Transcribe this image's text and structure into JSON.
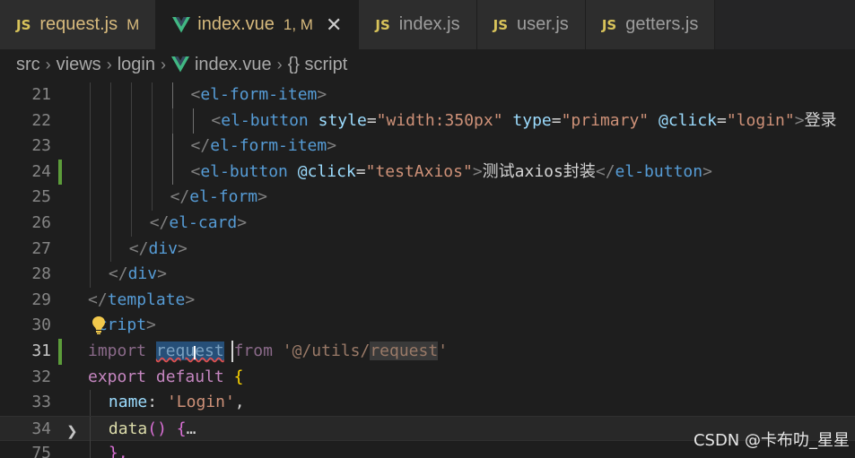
{
  "tabs": [
    {
      "icon": "js",
      "name": "request.js",
      "badge": "M",
      "active": false
    },
    {
      "icon": "vue",
      "name": "index.vue",
      "badge": "1, M",
      "active": true
    },
    {
      "icon": "js",
      "name": "index.js",
      "badge": "",
      "active": false
    },
    {
      "icon": "js",
      "name": "user.js",
      "badge": "",
      "active": false
    },
    {
      "icon": "js",
      "name": "getters.js",
      "badge": "",
      "active": false
    }
  ],
  "tab_close_glyph": "✕",
  "breadcrumb": {
    "parts": [
      "src",
      "views",
      "login"
    ],
    "file": "index.vue",
    "symbol": "{} script"
  },
  "lines": [
    {
      "n": "21",
      "indent": 5,
      "tokens": [
        [
          "t-bracket",
          "<"
        ],
        [
          "t-tag",
          "el-form-item"
        ],
        [
          "t-bracket",
          ">"
        ]
      ]
    },
    {
      "n": "22",
      "indent": 6,
      "tokens": [
        [
          "t-bracket",
          "<"
        ],
        [
          "t-tag",
          "el-button"
        ],
        [
          "t-text",
          " "
        ],
        [
          "t-attr",
          "style"
        ],
        [
          "t-text",
          "="
        ],
        [
          "t-str",
          "\"width:350px\""
        ],
        [
          "t-text",
          " "
        ],
        [
          "t-attr",
          "type"
        ],
        [
          "t-text",
          "="
        ],
        [
          "t-str",
          "\"primary\""
        ],
        [
          "t-text",
          " "
        ],
        [
          "t-attr",
          "@click"
        ],
        [
          "t-text",
          "="
        ],
        [
          "t-str",
          "\"login\""
        ],
        [
          "t-bracket",
          ">"
        ],
        [
          "t-text",
          "登录"
        ]
      ]
    },
    {
      "n": "23",
      "indent": 5,
      "tokens": [
        [
          "t-bracket",
          "</"
        ],
        [
          "t-tag",
          "el-form-item"
        ],
        [
          "t-bracket",
          ">"
        ]
      ]
    },
    {
      "n": "24",
      "indent": 5,
      "mod": true,
      "tokens": [
        [
          "t-bracket",
          "<"
        ],
        [
          "t-tag",
          "el-button"
        ],
        [
          "t-text",
          " "
        ],
        [
          "t-attr",
          "@click"
        ],
        [
          "t-text",
          "="
        ],
        [
          "t-str",
          "\"testAxios\""
        ],
        [
          "t-bracket",
          ">"
        ],
        [
          "t-text",
          "测试axios封装"
        ],
        [
          "t-bracket",
          "</"
        ],
        [
          "t-tag",
          "el-button"
        ],
        [
          "t-bracket",
          ">"
        ]
      ]
    },
    {
      "n": "25",
      "indent": 4,
      "tokens": [
        [
          "t-bracket",
          "</"
        ],
        [
          "t-tag",
          "el-form"
        ],
        [
          "t-bracket",
          ">"
        ]
      ]
    },
    {
      "n": "26",
      "indent": 3,
      "tokens": [
        [
          "t-bracket",
          "</"
        ],
        [
          "t-tag",
          "el-card"
        ],
        [
          "t-bracket",
          ">"
        ]
      ]
    },
    {
      "n": "27",
      "indent": 2,
      "tokens": [
        [
          "t-bracket",
          "</"
        ],
        [
          "t-tag",
          "div"
        ],
        [
          "t-bracket",
          ">"
        ]
      ]
    },
    {
      "n": "28",
      "indent": 1,
      "tokens": [
        [
          "t-bracket",
          "</"
        ],
        [
          "t-tag",
          "div"
        ],
        [
          "t-bracket",
          ">"
        ]
      ]
    },
    {
      "n": "29",
      "indent": 0,
      "tokens": [
        [
          "t-bracket",
          "</"
        ],
        [
          "t-tag",
          "template"
        ],
        [
          "t-bracket",
          ">"
        ]
      ]
    },
    {
      "n": "30",
      "indent": 0,
      "bulb": true,
      "tokens": [
        [
          "t-text",
          " "
        ],
        [
          "t-tag",
          "cript"
        ],
        [
          "t-bracket",
          ">"
        ]
      ]
    },
    {
      "n": "31",
      "indent": 0,
      "mod": true,
      "current": true,
      "tokens": [
        [
          "t-kw-dim",
          "import"
        ],
        [
          "t-text",
          " "
        ],
        [
          "t-var-dim sel",
          "request"
        ],
        [
          "t-text",
          " "
        ],
        [
          "t-kw-dim",
          "from"
        ],
        [
          "t-text",
          " "
        ],
        [
          "t-str-dim",
          "'@/utils/"
        ],
        [
          "t-str-dim hl",
          "request"
        ],
        [
          "t-str-dim",
          "'"
        ]
      ]
    },
    {
      "n": "32",
      "indent": 0,
      "tokens": [
        [
          "t-kw",
          "export"
        ],
        [
          "t-text",
          " "
        ],
        [
          "t-kw",
          "default"
        ],
        [
          "t-text",
          " "
        ],
        [
          "t-brace",
          "{"
        ]
      ]
    },
    {
      "n": "33",
      "indent": 1,
      "tokens": [
        [
          "t-prop",
          "name"
        ],
        [
          "t-text",
          ": "
        ],
        [
          "t-str",
          "'Login'"
        ],
        [
          "t-text",
          ","
        ]
      ]
    },
    {
      "n": "34",
      "indent": 1,
      "fold": true,
      "current2": true,
      "tokens": [
        [
          "t-fn",
          "data"
        ],
        [
          "t-paren",
          "()"
        ],
        [
          "t-text",
          " "
        ],
        [
          "t-paren",
          "{"
        ],
        [
          "t-text",
          "…"
        ]
      ]
    },
    {
      "n": "75",
      "indent": 1,
      "tokens": [
        [
          "t-paren",
          "},"
        ]
      ]
    }
  ],
  "watermark": "CSDN @卡布叻_星星"
}
